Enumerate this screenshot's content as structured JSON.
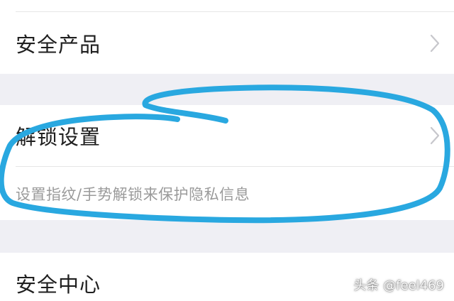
{
  "settings": {
    "items": [
      {
        "label": "安全产品",
        "icon": "chevron-right-icon"
      },
      {
        "label": "解锁设置",
        "description": "设置指纹/手势解锁来保护隐私信息",
        "icon": "chevron-right-icon"
      },
      {
        "label": "安全中心"
      }
    ]
  },
  "annotation": {
    "color": "#29a8e0"
  },
  "watermark": {
    "text": "头条 @feel469"
  },
  "colors": {
    "background": "#efeff4",
    "card": "#ffffff",
    "chevron": "#c7c7cc"
  }
}
